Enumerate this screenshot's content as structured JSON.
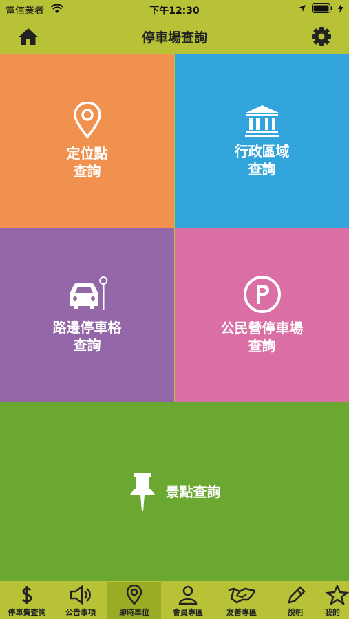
{
  "status": {
    "carrier": "電信業者",
    "time": "下午12:30"
  },
  "nav": {
    "title": "停車場查詢"
  },
  "tiles": [
    {
      "line1": "定位點",
      "line2": "查詢"
    },
    {
      "line1": "行政區域",
      "line2": "查詢"
    },
    {
      "line1": "路邊停車格",
      "line2": "查詢"
    },
    {
      "line1": "公民營停車場",
      "line2": "查詢"
    },
    {
      "line1": "景點查詢"
    }
  ],
  "tabs": [
    {
      "label": "停車費查詢"
    },
    {
      "label": "公告事項"
    },
    {
      "label": "即時車位",
      "active": true
    },
    {
      "label": "會員專區"
    },
    {
      "label": "友善專區"
    },
    {
      "label": "說明"
    },
    {
      "label": "我的"
    }
  ],
  "colors": {
    "bar": "#b7c236",
    "orange": "#f0914f",
    "blue": "#31a4dc",
    "purple": "#9468a8",
    "pink": "#da6fa5",
    "green": "#6aa832"
  }
}
